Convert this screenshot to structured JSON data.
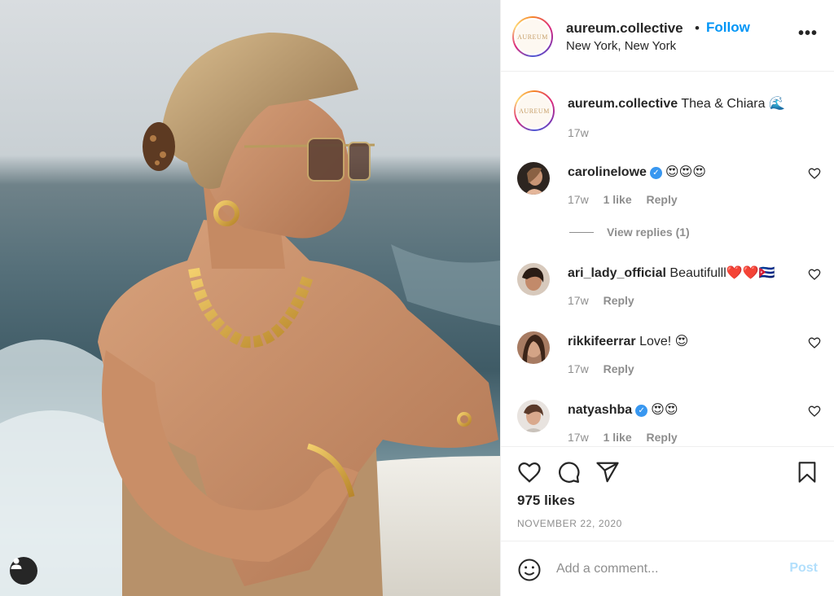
{
  "photo": {
    "description_icon": "user-tag-icon"
  },
  "header": {
    "username": "aureum.collective",
    "separator": "•",
    "follow_label": "Follow",
    "location": "New York, New York",
    "avatar_logo_text": "AUREUM",
    "more_label": "•••"
  },
  "caption": {
    "username": "aureum.collective",
    "text": "Thea & Chiara 🌊",
    "time": "17w"
  },
  "comments": [
    {
      "username": "carolinelowe",
      "verified": true,
      "text": "😍😍😍",
      "time": "17w",
      "likes": "1 like",
      "reply": "Reply"
    },
    {
      "username": "ari_lady_official",
      "verified": false,
      "text": "Beautifulll❤️❤️🇨🇺",
      "time": "17w",
      "reply": "Reply"
    },
    {
      "username": "rikkifeerrar",
      "verified": false,
      "text": "Love! 😍",
      "time": "17w",
      "reply": "Reply"
    },
    {
      "username": "natyashba",
      "verified": true,
      "text": "😍😍",
      "time": "17w",
      "likes": "1 like",
      "reply": "Reply"
    }
  ],
  "view_replies": "View replies (1)",
  "verified_glyph": "✓",
  "actions": {
    "likes": "975 likes",
    "date": "NOVEMBER 22, 2020"
  },
  "add_comment": {
    "placeholder": "Add a comment...",
    "post_label": "Post"
  },
  "colors": {
    "accent_blue": "#0095f6",
    "post_disabled": "#b2dffc",
    "muted_text": "#8e8e8e"
  }
}
